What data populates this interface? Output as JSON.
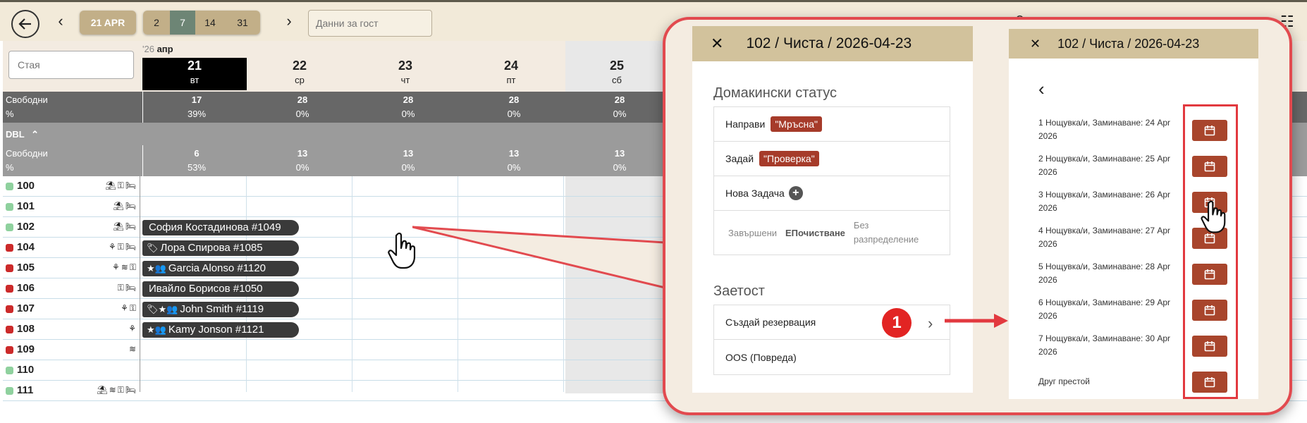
{
  "toolbar": {
    "date_label": "21 APR",
    "ranges": [
      "2",
      "7",
      "14",
      "31"
    ],
    "active_range": "7",
    "prev_arrow": "‹",
    "next_arrow": "›",
    "guest_placeholder": "Данни за гост"
  },
  "grid": {
    "room_search_placeholder": "Стая",
    "month_year": "'26",
    "month": "апр",
    "days": [
      {
        "num": "21",
        "name": "вт"
      },
      {
        "num": "22",
        "name": "ср"
      },
      {
        "num": "23",
        "name": "чт"
      },
      {
        "num": "24",
        "name": "пт"
      },
      {
        "num": "25",
        "name": "сб"
      }
    ],
    "free_label": "Свободни",
    "pct_label": "%",
    "totals": [
      {
        "free": "17",
        "pct": "39%"
      },
      {
        "free": "28",
        "pct": "0%"
      },
      {
        "free": "28",
        "pct": "0%"
      },
      {
        "free": "28",
        "pct": "0%"
      },
      {
        "free": "28",
        "pct": "0%"
      }
    ],
    "group_label": "DBL",
    "group_totals": [
      {
        "free": "6",
        "pct": "53%"
      },
      {
        "free": "13",
        "pct": "0%"
      },
      {
        "free": "13",
        "pct": "0%"
      },
      {
        "free": "13",
        "pct": "0%"
      },
      {
        "free": "13",
        "pct": "0%"
      }
    ],
    "rooms": [
      {
        "num": "100",
        "status_color": "#8fd19e",
        "icons": "⛱⚿🛏"
      },
      {
        "num": "101",
        "status_color": "#8fd19e",
        "icons": "⛱🛏"
      },
      {
        "num": "102",
        "status_color": "#8fd19e",
        "icons": "⛱🛏"
      },
      {
        "num": "104",
        "status_color": "#cc2a2a",
        "icons": "⚘⚿🛏"
      },
      {
        "num": "105",
        "status_color": "#cc2a2a",
        "icons": "⚘≋⚿"
      },
      {
        "num": "106",
        "status_color": "#cc2a2a",
        "icons": "⚿🛏"
      },
      {
        "num": "107",
        "status_color": "#cc2a2a",
        "icons": "⚘⚿"
      },
      {
        "num": "108",
        "status_color": "#cc2a2a",
        "icons": "⚘"
      },
      {
        "num": "109",
        "status_color": "#cc2a2a",
        "icons": "≋"
      },
      {
        "num": "110",
        "status_color": "#8fd19e",
        "icons": ""
      },
      {
        "num": "111",
        "status_color": "#8fd19e",
        "icons": "⛱≋⚿🛏"
      }
    ],
    "bookings": [
      {
        "row": 2,
        "icons": "",
        "text": "София Костадинова #1049"
      },
      {
        "row": 3,
        "icons": "🏷",
        "text": "Лора Спирова #1085"
      },
      {
        "row": 4,
        "icons": "★👥",
        "text": "Garcia Alonso #1120"
      },
      {
        "row": 5,
        "icons": "",
        "text": "Ивайло Борисов #1050"
      },
      {
        "row": 6,
        "icons": "🏷★👥",
        "text": "John Smith #1119"
      },
      {
        "row": 7,
        "icons": "★👥",
        "text": "Kamy Jonson #1121"
      }
    ]
  },
  "panel1": {
    "title": "102 / Чиста / 2026-04-23",
    "close": "✕",
    "housekeeping_title": "Домакински статус",
    "make_label": "Направи",
    "make_tag": "\"Мръсна\"",
    "assign_label": "Задай",
    "assign_tag": "\"Проверка\"",
    "new_task_label": "Нова Задача",
    "filter_done": "Завършени",
    "filter_cleaning": "ЕПочистване",
    "filter_unassigned": "Без разпределение",
    "occupancy_title": "Заетост",
    "create_reservation": "Създай резервация",
    "badge": "1",
    "oos": "OOS (Повреда)"
  },
  "panel2": {
    "title": "102  / Чиста / 2026-04-23",
    "close": "✕",
    "back": "‹",
    "options": [
      "1 Нощувка/и, Заминаване: 24 Apr 2026",
      "2 Нощувка/и, Заминаване: 25 Apr 2026",
      "3 Нощувка/и, Заминаване: 26 Apr 2026",
      "4 Нощувка/и, Заминаване: 27 Apr 2026",
      "5 Нощувка/и, Заминаване: 28 Apr 2026",
      "6 Нощувка/и, Заминаване: 29 Apr 2026",
      "7 Нощувка/и, Заминаване: 30 Apr 2026",
      "Друг престой"
    ]
  },
  "colors": {
    "accent_tan": "#c2af88",
    "active_green": "#6d8575",
    "brick": "#a8452c",
    "callout_red": "#e24a4f"
  }
}
